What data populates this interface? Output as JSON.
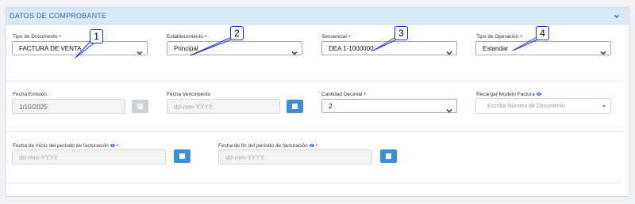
{
  "panel": {
    "title": "DATOS DE COMPROBANTE",
    "collapse_icon": "chevron-down-icon"
  },
  "row1": {
    "tipo_documento": {
      "label": "Tipo de Documento",
      "value": "FACTURA DE VENTA"
    },
    "establecimiento": {
      "label": "Establecimiento",
      "value": "Principal"
    },
    "secuencial": {
      "label": "Secuencial",
      "value": "DEA 1-1000000"
    },
    "tipo_operacion": {
      "label": "Tipo de Operación",
      "value": "Estandar"
    }
  },
  "row2": {
    "fecha_emision": {
      "label": "Fecha Emisión",
      "value": "1/10/2025"
    },
    "fecha_vencimiento": {
      "label": "Fecha Vencimiento",
      "placeholder": "dd-mm-YYYY"
    },
    "cantidad_decimal": {
      "label": "Cantidad Decimal",
      "value": "2"
    },
    "recargar_modelo": {
      "label": "Recargar Modelo Factura",
      "placeholder": "Escriba Número de Documento"
    }
  },
  "row3": {
    "fecha_inicio": {
      "label": "Fecha de inicio del período de facturación",
      "placeholder": "dd-mm-YYYY"
    },
    "fecha_fin": {
      "label": "Fecha de fin del período de facturación",
      "placeholder": "dd-mm-YYYY"
    }
  },
  "callouts": [
    "1",
    "2",
    "3",
    "4"
  ],
  "colors": {
    "header_bg": "#d9e9f5",
    "title": "#3a6f9a",
    "required": "#e53935",
    "button": "#3a8fd9",
    "callout_border": "#1b2fd6"
  }
}
